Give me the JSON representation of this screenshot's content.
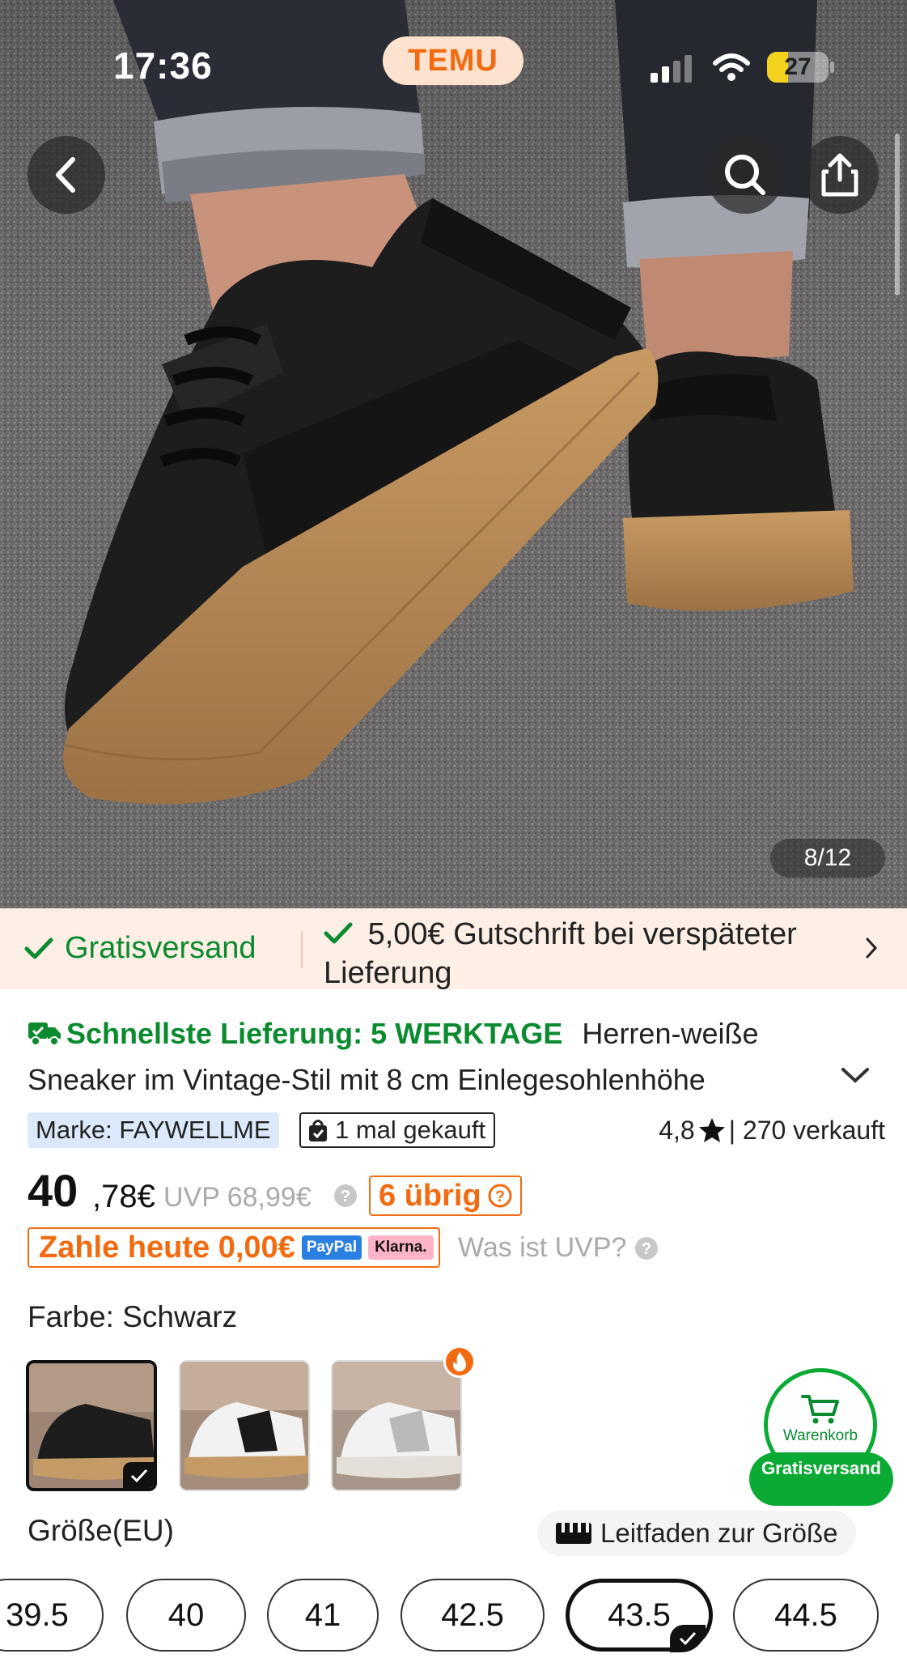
{
  "status_bar": {
    "time": "17:36",
    "app_badge": "TEMU",
    "battery": "27"
  },
  "hero": {
    "image_counter": "8/12"
  },
  "banner": {
    "free_shipping": "Gratisversand",
    "late_credit": "5,00€ Gutschrift bei verspäteter Lieferung"
  },
  "product": {
    "delivery": "Schnellste Lieferung: 5 WERKTAGE",
    "title": "Herren-weiße Sneaker im Vintage-Stil mit 8 cm Einlegesohlenhöhe",
    "brand": "Marke: FAYWELLME",
    "bought": "1 mal gekauft",
    "rating_value": "4,8",
    "sold": "| 270 verkauft",
    "price_int": "40",
    "price_dec": ",78€",
    "uvp": "UVP 68,99€",
    "stock": "6 übrig",
    "pay_today": "Zahle heute 0,00€",
    "paypal": "PayPal",
    "klarna": "Klarna.",
    "uvp_question": "Was ist UVP?"
  },
  "color": {
    "label": "Farbe: Schwarz",
    "swatches": [
      "black",
      "white-black",
      "white-grey"
    ],
    "selected_index": 0
  },
  "cart": {
    "label": "Warenkorb",
    "pill": "Gratisversand"
  },
  "size": {
    "label": "Größe(EU)",
    "guide": "Leitfaden zur Größe",
    "options": [
      "39.5",
      "40",
      "41",
      "42.5",
      "43.5",
      "44.5"
    ],
    "selected": "43.5"
  },
  "colors": {
    "temu_orange": "#f26b10",
    "green": "#0b8a2f",
    "banner_bg": "#fdeee6",
    "brand_bg": "#dce9fb"
  }
}
